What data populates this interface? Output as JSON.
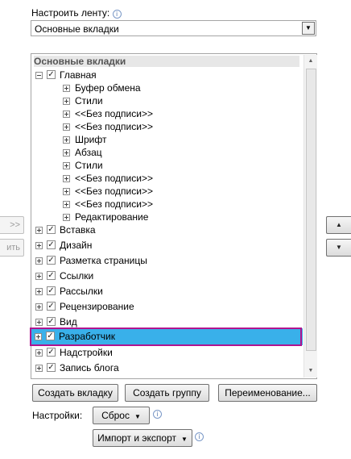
{
  "header": {
    "customize_label": "Настроить ленту:"
  },
  "combo": {
    "value": "Основные вкладки",
    "arrow_glyph": "▼"
  },
  "tree": {
    "header": "Основные вкладки",
    "items": [
      {
        "level": 0,
        "expander": "minus",
        "checked": true,
        "label": "Главная"
      },
      {
        "level": 1,
        "expander": "plus",
        "checked": null,
        "label": "Буфер обмена"
      },
      {
        "level": 1,
        "expander": "plus",
        "checked": null,
        "label": "Стили"
      },
      {
        "level": 1,
        "expander": "plus",
        "checked": null,
        "label": "<<Без подписи>>"
      },
      {
        "level": 1,
        "expander": "plus",
        "checked": null,
        "label": "<<Без подписи>>"
      },
      {
        "level": 1,
        "expander": "plus",
        "checked": null,
        "label": "Шрифт"
      },
      {
        "level": 1,
        "expander": "plus",
        "checked": null,
        "label": "Абзац"
      },
      {
        "level": 1,
        "expander": "plus",
        "checked": null,
        "label": "Стили"
      },
      {
        "level": 1,
        "expander": "plus",
        "checked": null,
        "label": "<<Без подписи>>"
      },
      {
        "level": 1,
        "expander": "plus",
        "checked": null,
        "label": "<<Без подписи>>"
      },
      {
        "level": 1,
        "expander": "plus",
        "checked": null,
        "label": "<<Без подписи>>"
      },
      {
        "level": 1,
        "expander": "plus",
        "checked": null,
        "label": "Редактирование"
      },
      {
        "level": 0,
        "expander": "plus",
        "checked": true,
        "label": "Вставка"
      },
      {
        "level": 0,
        "expander": "plus",
        "checked": true,
        "label": "Дизайн"
      },
      {
        "level": 0,
        "expander": "plus",
        "checked": true,
        "label": "Разметка страницы"
      },
      {
        "level": 0,
        "expander": "plus",
        "checked": true,
        "label": "Ссылки"
      },
      {
        "level": 0,
        "expander": "plus",
        "checked": true,
        "label": "Рассылки"
      },
      {
        "level": 0,
        "expander": "plus",
        "checked": true,
        "label": "Рецензирование"
      },
      {
        "level": 0,
        "expander": "plus",
        "checked": true,
        "label": "Вид"
      },
      {
        "level": 0,
        "expander": "plus",
        "checked": true,
        "label": "Разработчик",
        "selected": true
      },
      {
        "level": 0,
        "expander": "plus",
        "checked": true,
        "label": "Надстройки"
      },
      {
        "level": 0,
        "expander": "plus",
        "checked": true,
        "label": "Запись блога"
      }
    ]
  },
  "side_buttons": {
    "add": ">>",
    "remove": "ить",
    "up_glyph": "▲",
    "down_glyph": "▼"
  },
  "buttons": {
    "create_tab": "Создать вкладку",
    "create_group": "Создать группу",
    "rename": "Переименование..."
  },
  "settings": {
    "label": "Настройки:",
    "reset": "Сброс",
    "import_export": "Импорт и экспорт",
    "dropdown_glyph": "▼"
  },
  "info_glyph": "i",
  "colors": {
    "selection": "#39b0ea",
    "highlight_border": "#b0148f"
  }
}
